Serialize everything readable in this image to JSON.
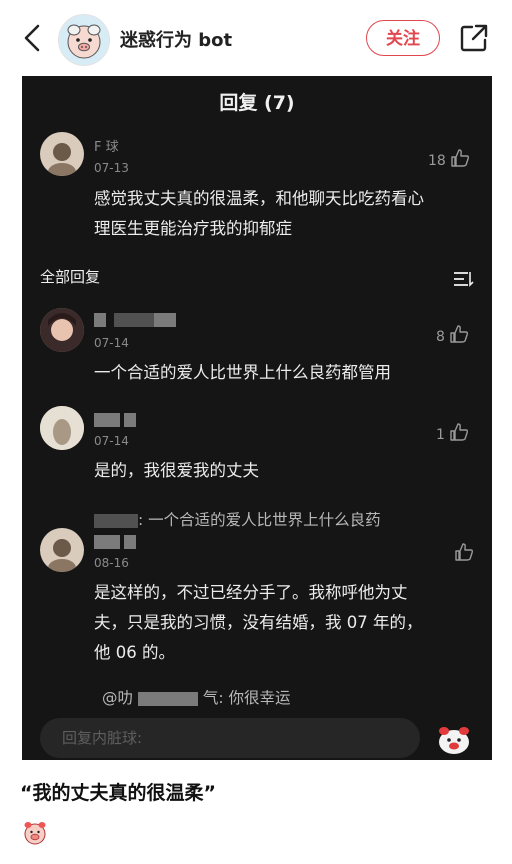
{
  "header": {
    "account_name": "迷惑行为 bot",
    "follow_label": "关注",
    "back_icon": "back-arrow-icon",
    "share_icon": "share-icon"
  },
  "screenshot": {
    "title": "回复 (7)",
    "main_comment": {
      "username": "F 球",
      "date": "07-13",
      "likes": "18",
      "text_lines": [
        "感觉我丈夫真的很温柔，和他聊天比吃药看心",
        "理医生更能治疗我的抑郁症"
      ]
    },
    "section_label": "全部回复",
    "replies": [
      {
        "date": "07-14",
        "likes": "8",
        "text_lines": [
          "一个合适的爱人比世界上什么良药都管用"
        ]
      },
      {
        "date": "07-14",
        "likes": "1",
        "text_lines": [
          "是的，我很爱我的丈夫"
        ]
      },
      {
        "quote": ": 一个合适的爱人比世界上什么良药",
        "date": "08-16",
        "likes": "",
        "text_lines": [
          "是这样的，不过已经分手了。我称呼他为丈",
          "夫，只是我的习惯，没有结婚，我 07 年的，",
          "他 06 的。"
        ],
        "bottom_quote_prefix": "@叻",
        "bottom_quote_suffix": "气: 你很幸运"
      }
    ],
    "reply_placeholder": "回复内脏球:"
  },
  "caption": "“我的丈夫真的很温柔”",
  "colors": {
    "accent": "#e1474e",
    "dark_bg": "#151515"
  }
}
